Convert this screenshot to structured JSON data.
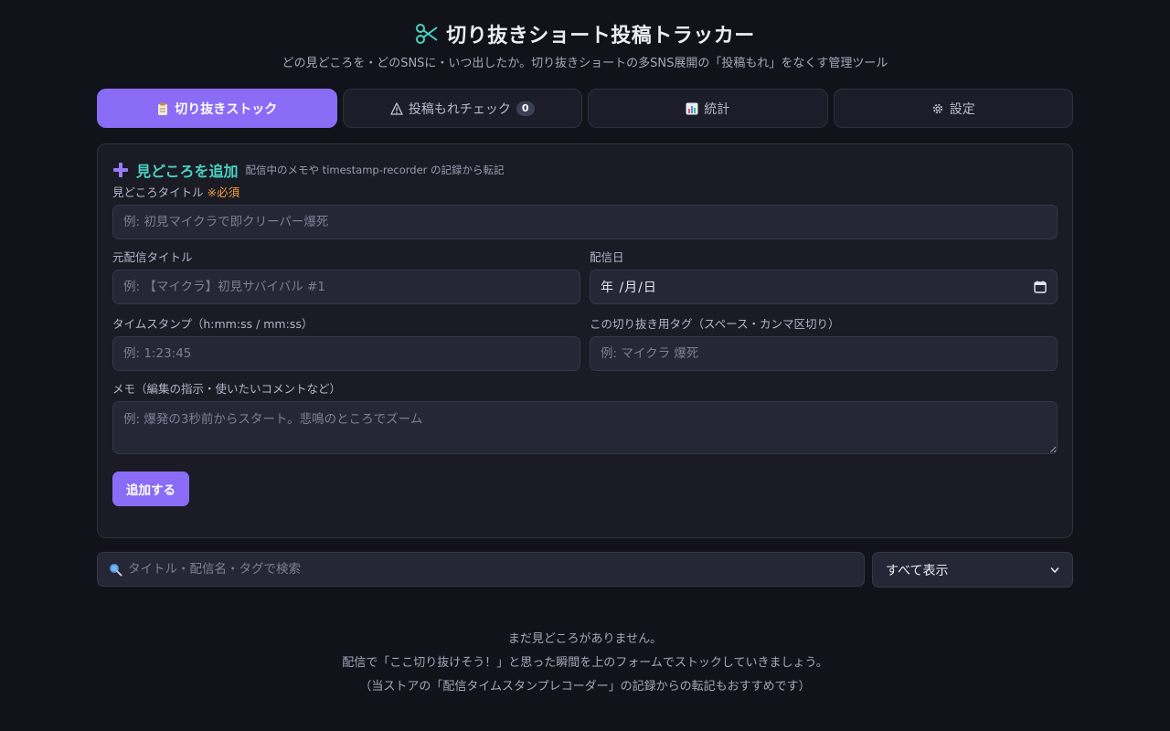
{
  "header": {
    "title": "切り抜きショート投稿トラッカー",
    "title_icon": "scissors-icon",
    "subtitle": "どの見どころを・どのSNSに・いつ出したか。切り抜きショートの多SNS展開の「投稿もれ」をなくす管理ツール"
  },
  "tabs": [
    {
      "label": "切り抜きストック",
      "icon": "clipboard-icon",
      "active": true
    },
    {
      "label": "投稿もれチェック",
      "icon": "warning-icon",
      "badge": "0"
    },
    {
      "label": "統計",
      "icon": "bar-chart-icon"
    },
    {
      "label": "設定",
      "icon": "gear-icon"
    }
  ],
  "form": {
    "heading": "見どころを追加",
    "heading_icon": "plus-icon",
    "note": "配信中のメモや timestamp-recorder の記録から転記",
    "title_label": "見どころタイトル",
    "title_required": "※必須",
    "title_placeholder": "例: 初見マイクラで即クリーパー爆死",
    "stream_label": "元配信タイトル",
    "stream_placeholder": "例: 【マイクラ】初見サバイバル #1",
    "date_label": "配信日",
    "date_value": "年 /月/日",
    "timestamp_label": "タイムスタンプ（h:mm:ss / mm:ss）",
    "timestamp_placeholder": "例: 1:23:45",
    "tags_label": "この切り抜き用タグ（スペース・カンマ区切り）",
    "tags_placeholder": "例: マイクラ 爆死",
    "memo_label": "メモ（編集の指示・使いたいコメントなど）",
    "memo_placeholder": "例: 爆発の3秒前からスタート。悲鳴のところでズーム",
    "submit_label": "追加する"
  },
  "search": {
    "placeholder": "タイトル・配信名・タグで検索",
    "filter_selected": "すべて表示"
  },
  "empty_state": {
    "line1": "まだ見どころがありません。",
    "line2": "配信で「ここ切り抜けそう！」と思った瞬間を上のフォームでストックしていきましょう。",
    "line3": "（当ストアの「配信タイムスタンプレコーダー」の記録からの転記もおすすめです）"
  },
  "colors": {
    "background": "#12131a",
    "accent": "#8b6cf6",
    "heading_teal": "#4ad2c0",
    "required_orange": "#f2a03c"
  }
}
